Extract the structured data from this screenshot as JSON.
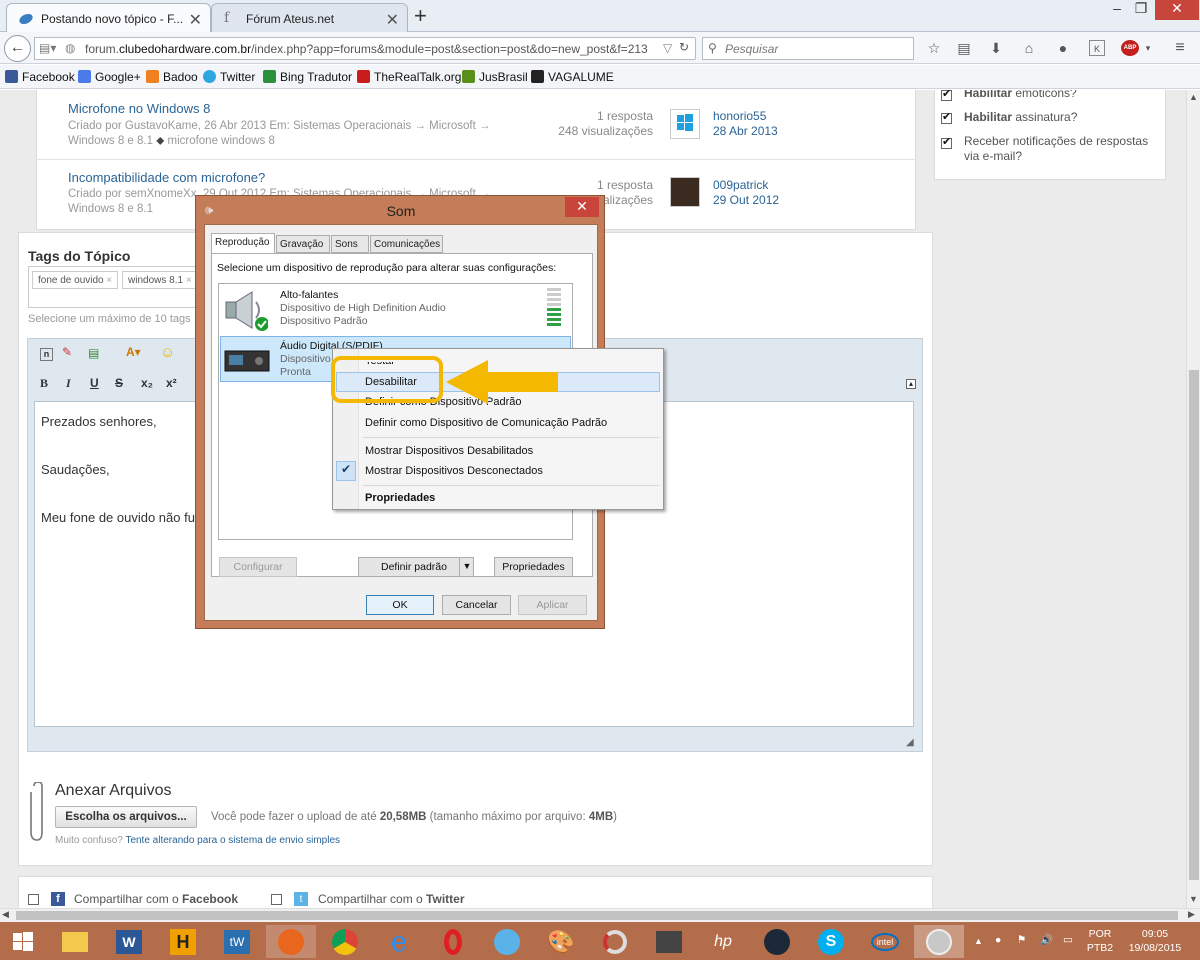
{
  "browser": {
    "tabs": [
      {
        "title": "Postando novo tópico - F..."
      },
      {
        "title": "Fórum Ateus.net"
      }
    ],
    "url_prefix": "forum.",
    "url_domain": "clubedohardware.com.br",
    "url_path": "/index.php?app=forums&module=post&section=post&do=new_post&f=213",
    "search_placeholder": "Pesquisar",
    "bookmarks": [
      "Facebook",
      "Google+",
      "Badoo",
      "Twitter",
      "Bing Tradutor",
      "TheRealTalk.org",
      "JusBrasil",
      "VAGALUME"
    ]
  },
  "topics": [
    {
      "title": "Microfone no Windows 8",
      "meta1": "Criado por GustavoKame, 26 Abr 2013 Em: Sistemas Operacionais → Microsoft →",
      "meta2": "Windows 8 e 8.1",
      "tag": "microfone windows 8",
      "replies": "1 resposta",
      "views": "248 visualizações",
      "last_user": "honorio55",
      "last_date": "28 Abr 2013"
    },
    {
      "title": "Incompatibilidade com microfone?",
      "meta1": "Criado por semXnomeXx, 29 Out 2012 Em: Sistemas Operacionais → Microsoft →",
      "meta2": "Windows 8 e 8.1",
      "replies": "1 resposta",
      "views": "visualizações",
      "last_user": "009patrick",
      "last_date": "29 Out 2012"
    }
  ],
  "options": [
    {
      "bold": "Habilitar",
      "rest": " emoticons?",
      "checked": true
    },
    {
      "bold": "Habilitar",
      "rest": " assinatura?",
      "checked": true
    },
    {
      "bold": "",
      "rest": "Receber notificações de respostas",
      "rest2": "via e-mail?",
      "checked": true
    }
  ],
  "tags_section": {
    "title": "Tags do Tópico",
    "tags": [
      "fone de ouvido",
      "windows 8.1"
    ],
    "hint": "Selecione um máximo de 10 tags"
  },
  "editor": {
    "buttons": [
      "B",
      "I",
      "U",
      "S",
      "x₂",
      "x²"
    ],
    "lines": [
      "Prezados senhores,",
      "Saudações,",
      "Meu fone de ouvido não fu"
    ]
  },
  "attach": {
    "title": "Anexar Arquivos",
    "button": "Escolha os arquivos...",
    "info_pre": "Você pode fazer o upload de até ",
    "info_max": "20,58MB",
    "info_mid": " (tamanho máximo por arquivo: ",
    "info_file": "4MB",
    "info_end": ")",
    "confused": "Muito confuso?",
    "alt_link": "Tente alterando para o sistema de envio simples"
  },
  "share": {
    "facebook_pre": "Compartilhar com o ",
    "facebook": "Facebook",
    "twitter_pre": "Compartilhar com o ",
    "twitter": "Twitter"
  },
  "dialog": {
    "title": "Som",
    "tabs": [
      "Reprodução",
      "Gravação",
      "Sons",
      "Comunicações"
    ],
    "instruction": "Selecione um dispositivo de reprodução para alterar suas configurações:",
    "devices": [
      {
        "name": "Alto-falantes",
        "desc": "Dispositivo de High Definition Audio",
        "status": "Dispositivo Padrão"
      },
      {
        "name": "Áudio Digital (S/PDIF)",
        "desc": "Dispositivo",
        "status": "Pronta"
      }
    ],
    "btn_configure": "Configurar",
    "btn_default": "Definir padrão",
    "btn_properties": "Propriedades",
    "btn_ok": "OK",
    "btn_cancel": "Cancelar",
    "btn_apply": "Aplicar"
  },
  "context_menu": {
    "items": [
      {
        "label": "Testar"
      },
      {
        "label": "Desabilitar"
      },
      {
        "label": "Definir como Dispositivo Padrão"
      },
      {
        "label": "Definir como Dispositivo de Comunicação Padrão"
      },
      {
        "label": "Mostrar Dispositivos Desabilitados"
      },
      {
        "label": "Mostrar Dispositivos Desconectados"
      },
      {
        "label": "Propriedades"
      }
    ]
  },
  "taskbar": {
    "lang1": "POR",
    "lang2": "PTB2",
    "time": "09:05",
    "date": "19/08/2015"
  },
  "colors": {
    "accent_link": "#2a6496",
    "highlight": "#f5b800",
    "taskbar": "#b46d4b",
    "dialog_frame": "#c57c58"
  }
}
